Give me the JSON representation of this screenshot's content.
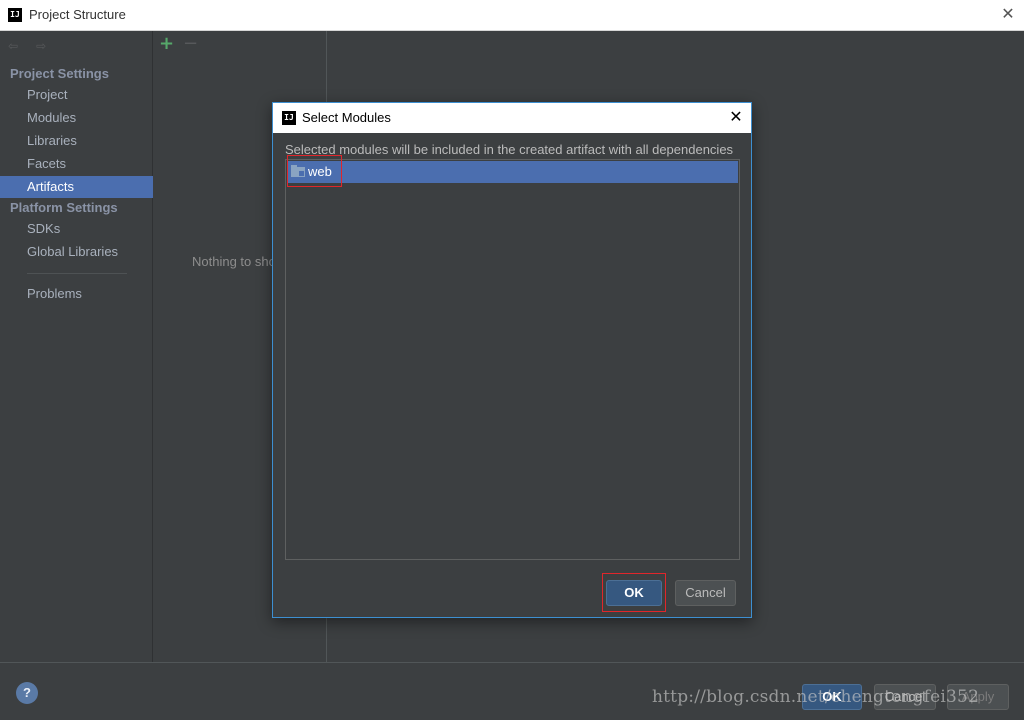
{
  "window": {
    "title": "Project Structure",
    "logo": "IJ",
    "close_glyph": "✕"
  },
  "nav": {
    "back_icon": "⇦",
    "forward_icon": "⇨",
    "section_project": "Project Settings",
    "section_platform": "Platform Settings",
    "items_project": [
      "Project",
      "Modules",
      "Libraries",
      "Facets",
      "Artifacts"
    ],
    "items_platform": [
      "SDKs",
      "Global Libraries"
    ],
    "problems": "Problems",
    "selected": "Artifacts"
  },
  "middle": {
    "add": "+",
    "remove": "−",
    "empty_text": "Nothing to show"
  },
  "footer": {
    "help": "?",
    "ok": "OK",
    "cancel": "Cancel",
    "apply": "Apply"
  },
  "watermark": "http://blog.csdn.net/chengtengfei352",
  "dialog": {
    "logo": "IJ",
    "title": "Select Modules",
    "close_glyph": "✕",
    "description": "Selected modules will be included in the created artifact with all dependencies",
    "modules": [
      "web"
    ],
    "ok": "OK",
    "cancel": "Cancel"
  },
  "colors": {
    "selection": "#4b6eaf",
    "highlight_box": "#e0262b",
    "dialog_border": "#3d8fd1"
  }
}
